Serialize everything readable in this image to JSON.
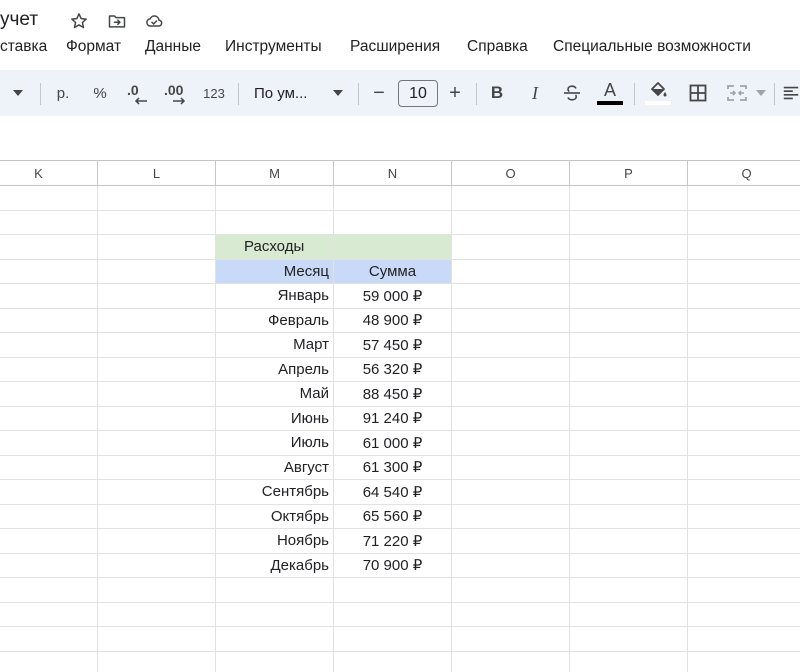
{
  "title_bar": {
    "doc_title": "учет",
    "icons": [
      "star-icon",
      "move-to-folder-icon",
      "cloud-saved-icon"
    ]
  },
  "menu": {
    "items": [
      {
        "label": "ставка"
      },
      {
        "label": "Формат"
      },
      {
        "label": "Данные"
      },
      {
        "label": "Инструменты"
      },
      {
        "label": "Расширения"
      },
      {
        "label": "Справка"
      },
      {
        "label": "Специальные возможности"
      }
    ]
  },
  "toolbar": {
    "currency_label": "р.",
    "percent_label": "%",
    "decrease_decimal_label": ".0",
    "increase_decimal_label": ".00",
    "more_formats_label": "123",
    "font_name": "По ум...",
    "font_size": "10",
    "minus_label": "−",
    "plus_label": "+",
    "bold_label": "B",
    "italic_label": "I",
    "text_color_label": "A"
  },
  "columns": [
    "K",
    "L",
    "M",
    "N",
    "O",
    "P",
    "Q"
  ],
  "sheet": {
    "title_cell": "Расходы",
    "header_month": "Месяц",
    "header_sum": "Сумма",
    "rows": [
      {
        "month": "Январь",
        "sum": "59 000 ₽"
      },
      {
        "month": "Февраль",
        "sum": "48 900 ₽"
      },
      {
        "month": "Март",
        "sum": "57 450 ₽"
      },
      {
        "month": "Апрель",
        "sum": "56 320 ₽"
      },
      {
        "month": "Май",
        "sum": "88 450 ₽"
      },
      {
        "month": "Июнь",
        "sum": "91 240 ₽"
      },
      {
        "month": "Июль",
        "sum": "61 000 ₽"
      },
      {
        "month": "Август",
        "sum": "61 300 ₽"
      },
      {
        "month": "Сентябрь",
        "sum": "64 540 ₽"
      },
      {
        "month": "Октябрь",
        "sum": "65 560 ₽"
      },
      {
        "month": "Ноябрь",
        "sum": "71 220 ₽"
      },
      {
        "month": "Декабрь",
        "sum": "70 900 ₽"
      }
    ]
  },
  "colors": {
    "title_fill": "#d9ead3",
    "header_fill": "#c9daf8",
    "toolbar_bg": "#eef2f9"
  }
}
